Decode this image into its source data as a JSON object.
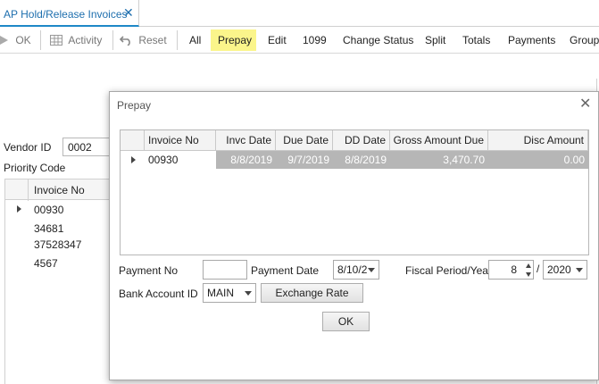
{
  "tab": {
    "title": "AP Hold/Release Invoices",
    "close": "✕"
  },
  "toolbar": {
    "ok": "OK",
    "activity": "Activity",
    "reset": "Reset",
    "all": "All",
    "prepay": "Prepay",
    "edit": "Edit",
    "n1099": "1099",
    "change_status": "Change Status",
    "split": "Split",
    "totals": "Totals",
    "payments": "Payments",
    "group": "Group"
  },
  "background": {
    "vendor_id_label": "Vendor ID",
    "vendor_id_value": "0002",
    "priority_code_label": "Priority Code",
    "grid_header": "Invoice No",
    "rows": [
      "00930",
      "34681",
      "37528347",
      "4567"
    ]
  },
  "dialog": {
    "title": "Prepay",
    "close": "✕",
    "grid": {
      "headers": [
        "Invoice No",
        "Invc Date",
        "Due Date",
        "DD Date",
        "Gross Amount Due",
        "Disc Amount"
      ],
      "rows": [
        [
          "00930",
          "8/8/2019",
          "9/7/2019",
          "8/8/2019",
          "3,470.70",
          "0.00"
        ]
      ]
    },
    "payment_no_label": "Payment No",
    "payment_no_value": "",
    "payment_date_label": "Payment Date",
    "payment_date_value": "8/10/2",
    "fiscal_label": "Fiscal Period/Year",
    "fiscal_period": "8",
    "fiscal_sep": "/",
    "fiscal_year": "2020",
    "bank_account_label": "Bank Account ID",
    "bank_account_value": "MAIN",
    "exchange_rate_button": "Exchange Rate",
    "ok_button": "OK"
  },
  "colors": {
    "accent": "#1e88c7",
    "highlight": "#fbf58b",
    "readonly_cell": "#b6b6b6"
  }
}
